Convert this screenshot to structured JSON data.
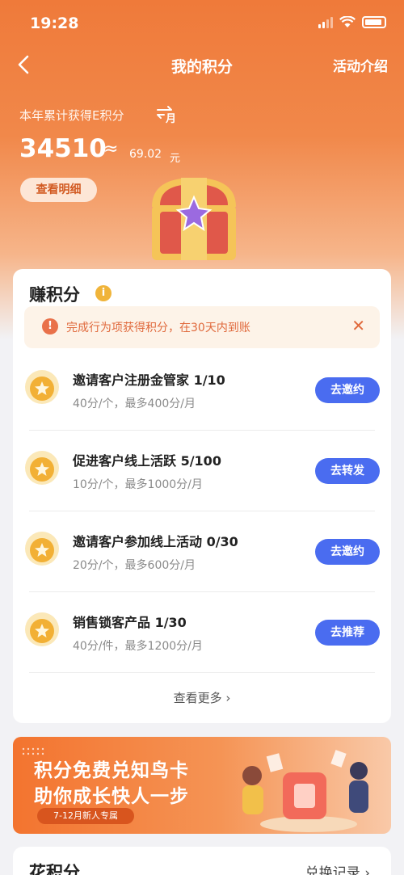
{
  "status": {
    "time": "19:28"
  },
  "nav": {
    "title": "我的积分",
    "right": "活动介绍"
  },
  "summary": {
    "label": "本年累计获得E积分",
    "points": "34510",
    "approx": "≈",
    "money": "69.02",
    "unit": "元",
    "detail_button": "查看明细"
  },
  "earn": {
    "title": "赚积分",
    "info": "i",
    "notice": "完成行为项获得积分，在30天内到账",
    "tasks": [
      {
        "title": "邀请客户注册金管家  1/10",
        "sub": "40分/个，最多400分/月",
        "button": "去邀约"
      },
      {
        "title": "促进客户线上活跃  5/100",
        "sub": "10分/个，最多1000分/月",
        "button": "去转发"
      },
      {
        "title": "邀请客户参加线上活动  0/30",
        "sub": "20分/个，最多600分/月",
        "button": "去邀约"
      },
      {
        "title": "销售锁客产品  1/30",
        "sub": "40分/件，最多1200分/月",
        "button": "去推荐"
      }
    ],
    "more": "查看更多 ›"
  },
  "banner": {
    "line1": "积分免费兑知鸟卡",
    "line2": "助你成长快人一步",
    "tag": "7-12月新人专属"
  },
  "spend": {
    "title": "花积分",
    "link": "兑换记录 ›"
  },
  "colors": {
    "primary_orange": "#ef7a3a",
    "button_blue": "#4a6cf0",
    "notice_text": "#e0693c"
  }
}
